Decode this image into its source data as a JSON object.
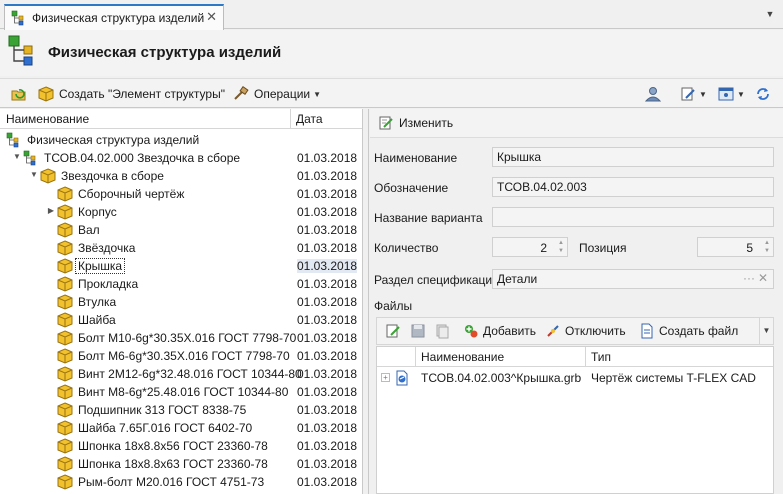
{
  "tab": {
    "label": "Физическая структура изделий",
    "close": "✕"
  },
  "header": {
    "title": "Физическая структура изделий"
  },
  "toolbar": {
    "create_label": "Создать \"Элемент структуры\"",
    "operations_label": "Операции"
  },
  "tree": {
    "col_name": "Наименование",
    "col_date": "Дата",
    "rows": [
      {
        "name": "Физическая структура изделий",
        "date": ""
      },
      {
        "name": "ТСОВ.04.02.000 Звездочка в сборе",
        "date": "01.03.2018"
      },
      {
        "name": "Звездочка в сборе",
        "date": "01.03.2018"
      },
      {
        "name": "Сборочный чертёж",
        "date": "01.03.2018"
      },
      {
        "name": "Корпус",
        "date": "01.03.2018"
      },
      {
        "name": "Вал",
        "date": "01.03.2018"
      },
      {
        "name": "Звёздочка",
        "date": "01.03.2018"
      },
      {
        "name": "Крышка",
        "date": "01.03.2018"
      },
      {
        "name": "Прокладка",
        "date": "01.03.2018"
      },
      {
        "name": "Втулка",
        "date": "01.03.2018"
      },
      {
        "name": "Шайба",
        "date": "01.03.2018"
      },
      {
        "name": "Болт М10-6g*30.35Х.016 ГОСТ 7798-70",
        "date": "01.03.2018"
      },
      {
        "name": "Болт М6-6g*30.35Х.016 ГОСТ 7798-70",
        "date": "01.03.2018"
      },
      {
        "name": "Винт 2М12-6g*32.48.016 ГОСТ 10344-80",
        "date": "01.03.2018"
      },
      {
        "name": "Винт М8-6g*25.48.016 ГОСТ 10344-80",
        "date": "01.03.2018"
      },
      {
        "name": "Подшипник 313 ГОСТ 8338-75",
        "date": "01.03.2018"
      },
      {
        "name": "Шайба 7.65Г.016 ГОСТ 6402-70",
        "date": "01.03.2018"
      },
      {
        "name": "Шпонка 18х8.8х56 ГОСТ 23360-78",
        "date": "01.03.2018"
      },
      {
        "name": "Шпонка 18х8.8х63 ГОСТ 23360-78",
        "date": "01.03.2018"
      },
      {
        "name": "Рым-болт М20.016 ГОСТ 4751-73",
        "date": "01.03.2018"
      }
    ]
  },
  "details": {
    "edit_label": "Изменить",
    "name_label": "Наименование",
    "name_value": "Крышка",
    "designation_label": "Обозначение",
    "designation_value": "ТСОВ.04.02.003",
    "variant_label": "Название варианта",
    "variant_value": "",
    "quantity_label": "Количество",
    "quantity_value": "2",
    "position_label": "Позиция",
    "position_value": "5",
    "section_label": "Раздел спецификации",
    "section_value": "Детали",
    "files_label": "Файлы",
    "add_label": "Добавить",
    "detach_label": "Отключить",
    "create_file_label": "Создать файл",
    "files_col_name": "Наименование",
    "files_col_type": "Тип",
    "files": [
      {
        "name": "ТСОВ.04.02.003^Крышка.grb",
        "type": "Чертёж системы T-FLEX CAD"
      }
    ]
  },
  "colors": {
    "accent": "#2e78c8",
    "cube": "#f2c12e",
    "selection": "#e3e9f2"
  }
}
